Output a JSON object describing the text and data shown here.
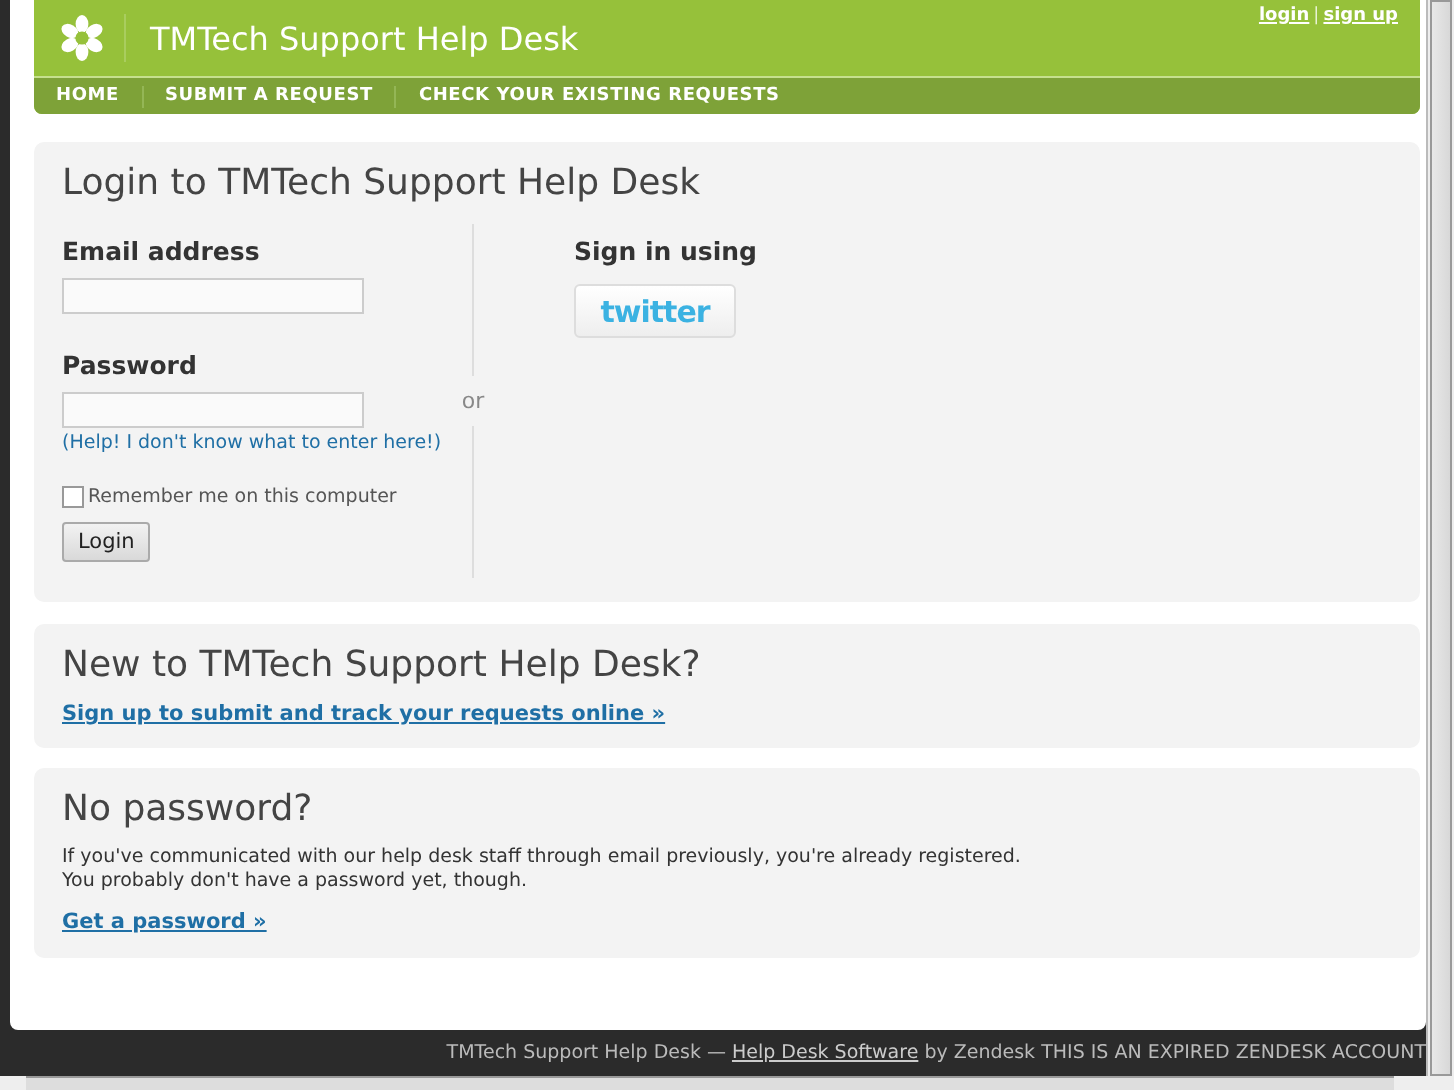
{
  "header": {
    "title": "TMTech Support Help Desk",
    "auth_links": [
      "login",
      "sign up"
    ],
    "auth_separator": "|",
    "nav": [
      {
        "label": "HOME"
      },
      {
        "label": "SUBMIT A REQUEST"
      },
      {
        "label": "CHECK YOUR EXISTING REQUESTS"
      }
    ]
  },
  "login": {
    "title": "Login to TMTech Support Help Desk",
    "email_label": "Email address",
    "password_label": "Password",
    "help_link": "(Help! I don't know what to enter here!)",
    "remember": {
      "label": "Remember me on this computer",
      "checked": false
    },
    "login_button": "Login",
    "separator": "or",
    "sign_in_label": "Sign in using",
    "twitter_button": "twitter"
  },
  "signup": {
    "title": "New to TMTech Support Help Desk?",
    "link": "Sign up to submit and track your requests online »"
  },
  "no_password": {
    "title": "No password?",
    "text": [
      "If you've communicated with our help desk staff through email previously, you're already registered.",
      "You probably don't have a password yet, though."
    ],
    "link": "Get a password »"
  },
  "footer": {
    "before": "TMTech Support Help Desk — ",
    "link": "Help Desk Software",
    "after": " by Zendesk THIS IS AN EXPIRED ZENDESK ACCOUNT"
  }
}
